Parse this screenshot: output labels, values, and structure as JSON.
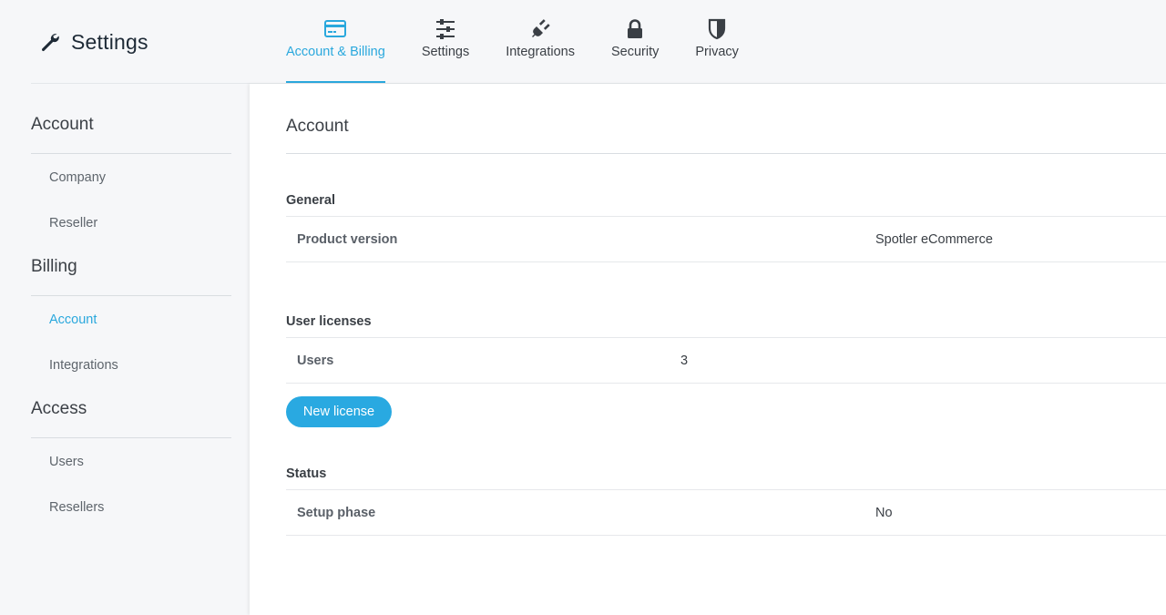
{
  "app": {
    "title": "Settings",
    "title_icon": "wrench-icon"
  },
  "tabs": [
    {
      "label": "Account & Billing",
      "icon": "credit-card-icon",
      "active": true
    },
    {
      "label": "Settings",
      "icon": "sliders-icon",
      "active": false
    },
    {
      "label": "Integrations",
      "icon": "plug-icon",
      "active": false
    },
    {
      "label": "Security",
      "icon": "lock-icon",
      "active": false
    },
    {
      "label": "Privacy",
      "icon": "shield-icon",
      "active": false
    }
  ],
  "sidebar": {
    "sections": [
      {
        "title": "Account",
        "items": [
          {
            "label": "Company",
            "active": false
          },
          {
            "label": "Reseller",
            "active": false
          }
        ]
      },
      {
        "title": "Billing",
        "items": [
          {
            "label": "Account",
            "active": true
          },
          {
            "label": "Integrations",
            "active": false
          }
        ]
      },
      {
        "title": "Access",
        "items": [
          {
            "label": "Users",
            "active": false
          },
          {
            "label": "Resellers",
            "active": false
          }
        ]
      }
    ]
  },
  "main": {
    "title": "Account",
    "general": {
      "title": "General",
      "product_version_label": "Product version",
      "product_version_value": "Spotler eCommerce"
    },
    "user_licenses": {
      "title": "User licenses",
      "users_label": "Users",
      "users_value": "3",
      "new_license_button": "New license"
    },
    "status": {
      "title": "Status",
      "setup_phase_label": "Setup phase",
      "setup_phase_value": "No"
    }
  },
  "colors": {
    "accent": "#2aa8dd",
    "button": "#29a9e1",
    "heading": "#1e2a36"
  }
}
